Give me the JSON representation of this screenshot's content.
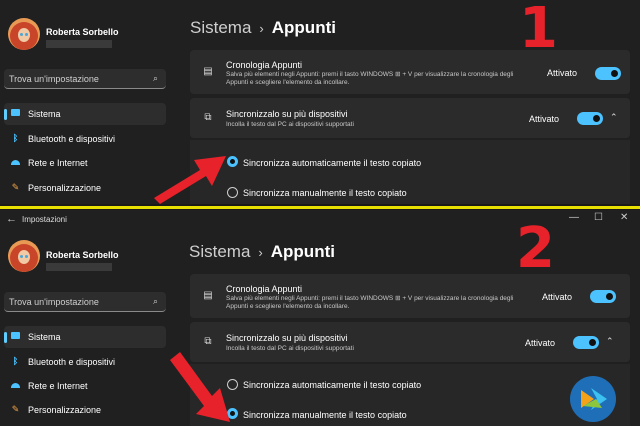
{
  "colors": {
    "accent": "#4cc2ff",
    "annotation": "#e8222a",
    "divider": "#e8e000"
  },
  "window": {
    "title": "Impostazioni"
  },
  "user": {
    "name": "Roberta Sorbello"
  },
  "search": {
    "placeholder": "Trova un'impostazione"
  },
  "sidebar": {
    "items": [
      {
        "label": "Sistema",
        "icon": "monitor-icon",
        "active": true
      },
      {
        "label": "Bluetooth e dispositivi",
        "icon": "bluetooth-icon"
      },
      {
        "label": "Rete e Internet",
        "icon": "wifi-icon"
      },
      {
        "label": "Personalizzazione",
        "icon": "brush-icon"
      }
    ]
  },
  "breadcrumb": {
    "parent": "Sistema",
    "separator": "›",
    "current": "Appunti"
  },
  "history": {
    "title": "Cronologia Appunti",
    "desc": "Salva più elementi negli Appunti: premi il tasto WINDOWS ⊞ + V per visualizzare la cronologia degli Appunti e scegliere l'elemento da incollare.",
    "state": "Attivato"
  },
  "sync": {
    "title": "Sincronizzalo su più dispositivi",
    "desc": "Incolla il testo dal PC ai dispositivi supportati",
    "state": "Attivato"
  },
  "options": {
    "auto": "Sincronizza automaticamente il testo copiato",
    "manual": "Sincronizza manualmente il testo copiato"
  },
  "panels": [
    {
      "label": "1",
      "selected": "auto"
    },
    {
      "label": "2",
      "selected": "manual"
    }
  ]
}
